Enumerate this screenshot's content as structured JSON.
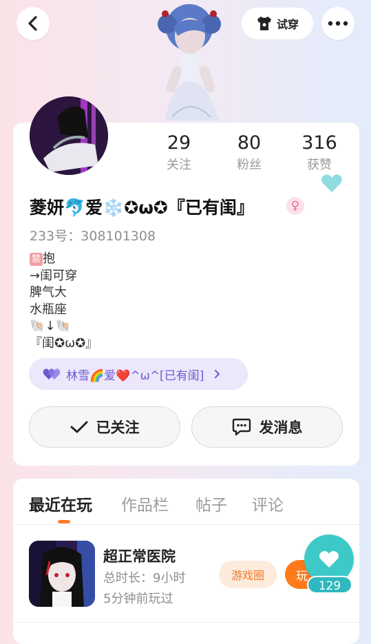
{
  "header": {
    "try_on_label": "试穿"
  },
  "profile": {
    "name": "菱妍🐬爱❄️✪ω✪『已有闺』",
    "gender_symbol": "♀",
    "uid_label": "233号：",
    "uid": "308101308",
    "bio_tag": "禁",
    "bio_lines": [
      "抱",
      "→闺可穿",
      "脾气大",
      "水瓶座",
      "🐚↓🐚",
      "『闺✪ω✪』"
    ],
    "stats": [
      {
        "value": "29",
        "label": "关注"
      },
      {
        "value": "80",
        "label": "粉丝"
      },
      {
        "value": "316",
        "label": "获赞"
      }
    ],
    "cp_badge": "林雪🌈爱❤️^ω^[已有闺]",
    "follow_button": "已关注",
    "message_button": "发消息"
  },
  "tabs": [
    "最近在玩",
    "作品栏",
    "帖子",
    "评论"
  ],
  "active_tab": 0,
  "recent_games": [
    {
      "title": "超正常医院",
      "duration": "总时长：9小时",
      "last_played": "5分钟前玩过",
      "circle_label": "游戏圈",
      "play_label": "玩"
    }
  ],
  "like_count": "129",
  "colors": {
    "accent": "#ff7a1a",
    "teal": "#3ec9c9",
    "cp": "#6d5bd0"
  }
}
